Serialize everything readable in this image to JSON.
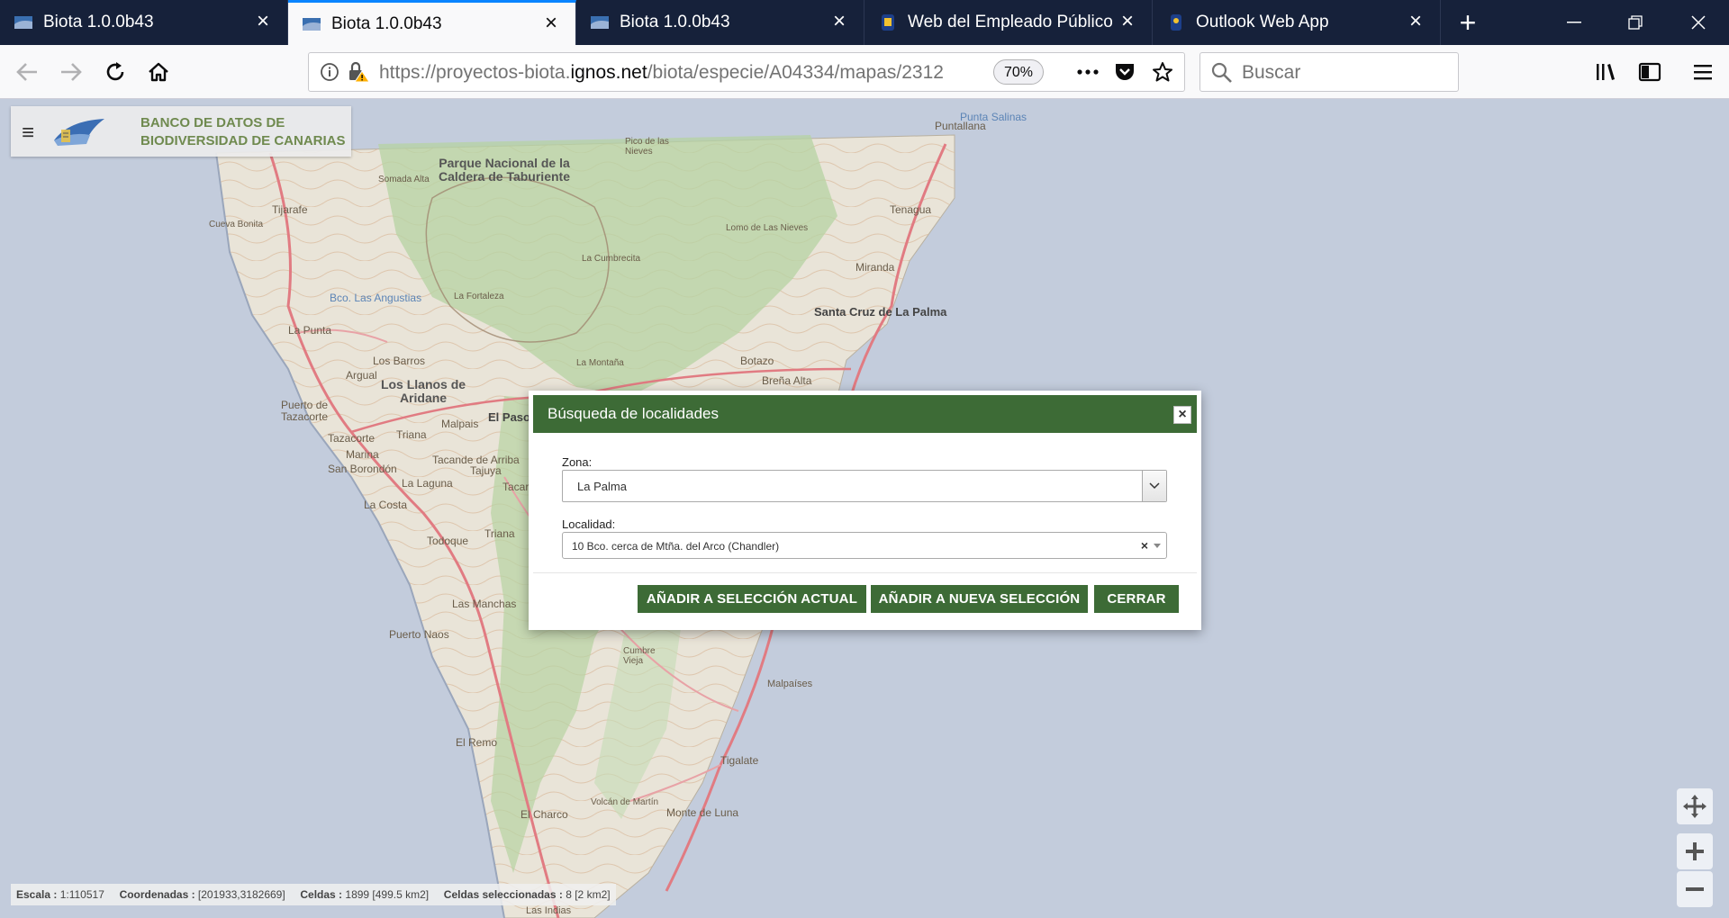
{
  "browser": {
    "tabs": [
      {
        "title": "Biota 1.0.0b43",
        "active": false,
        "icon": "biota-favicon"
      },
      {
        "title": "Biota 1.0.0b43",
        "active": true,
        "icon": "biota-favicon"
      },
      {
        "title": "Biota 1.0.0b43",
        "active": false,
        "icon": "biota-favicon"
      },
      {
        "title": "Web del Empleado Público - I",
        "active": false,
        "icon": "crest-favicon"
      },
      {
        "title": "Outlook Web App",
        "active": false,
        "icon": "crest-favicon"
      }
    ],
    "url": {
      "prefix": "https://proyectos-biota.",
      "domain": "ignos.net",
      "path": "/biota/especie/A04334/mapas/2312"
    },
    "zoom": "70%",
    "search_placeholder": "Buscar"
  },
  "brand": {
    "line1": "BANCO DE DATOS DE",
    "line2": "BIODIVERSIDAD DE CANARIAS"
  },
  "map_labels": [
    {
      "text": "Puntallana",
      "kind": "normal"
    },
    {
      "text": "Punta Salinas",
      "kind": "water"
    },
    {
      "text": "Pico de las Nieves",
      "kind": "normal"
    },
    {
      "text": "Parque Nacional de la Caldera de Taburiente",
      "kind": "big"
    },
    {
      "text": "Somada Alta",
      "kind": "normal"
    },
    {
      "text": "Tijarafe",
      "kind": "normal"
    },
    {
      "text": "Cueva Bonita",
      "kind": "normal"
    },
    {
      "text": "Tenagua",
      "kind": "normal"
    },
    {
      "text": "Lomo de Las Nieves",
      "kind": "normal"
    },
    {
      "text": "La Cumbrecita",
      "kind": "normal"
    },
    {
      "text": "Miranda",
      "kind": "normal"
    },
    {
      "text": "Bco. Las Angustias",
      "kind": "water"
    },
    {
      "text": "La Fortaleza",
      "kind": "normal"
    },
    {
      "text": "Santa Cruz de La Palma",
      "kind": "town"
    },
    {
      "text": "La Punta",
      "kind": "normal"
    },
    {
      "text": "Los Barros",
      "kind": "normal"
    },
    {
      "text": "La Montaña",
      "kind": "normal"
    },
    {
      "text": "Botazo",
      "kind": "normal"
    },
    {
      "text": "Argual",
      "kind": "normal"
    },
    {
      "text": "Los Llanos de Aridane",
      "kind": "big"
    },
    {
      "text": "Breña Alta",
      "kind": "normal"
    },
    {
      "text": "Puerto de Tazacorte",
      "kind": "normal"
    },
    {
      "text": "Malpais",
      "kind": "normal"
    },
    {
      "text": "El Paso",
      "kind": "town"
    },
    {
      "text": "Tazacorte",
      "kind": "normal"
    },
    {
      "text": "Triana",
      "kind": "normal"
    },
    {
      "text": "Marina",
      "kind": "normal"
    },
    {
      "text": "Tacande de Arriba",
      "kind": "normal"
    },
    {
      "text": "San Borondón",
      "kind": "normal"
    },
    {
      "text": "Tajuya",
      "kind": "normal"
    },
    {
      "text": "La Laguna",
      "kind": "normal"
    },
    {
      "text": "Tacar",
      "kind": "normal"
    },
    {
      "text": "La Costa",
      "kind": "normal"
    },
    {
      "text": "Triana",
      "kind": "normal"
    },
    {
      "text": "Todoque",
      "kind": "normal"
    },
    {
      "text": "Las Manchas",
      "kind": "normal"
    },
    {
      "text": "Puerto Naos",
      "kind": "normal"
    },
    {
      "text": "Cumbre Vieja",
      "kind": "normal"
    },
    {
      "text": "Malpaíses",
      "kind": "normal"
    },
    {
      "text": "El Remo",
      "kind": "normal"
    },
    {
      "text": "Tigalate",
      "kind": "normal"
    },
    {
      "text": "Volcán de Martín",
      "kind": "normal"
    },
    {
      "text": "El Charco",
      "kind": "normal"
    },
    {
      "text": "Monte de Luna",
      "kind": "normal"
    },
    {
      "text": "Las Indias",
      "kind": "normal"
    }
  ],
  "modal": {
    "title": "Búsqueda de localidades",
    "close_label": "×",
    "zona_label": "Zona:",
    "zona_value": "La Palma",
    "localidad_label": "Localidad:",
    "localidad_value": "10 Bco. cerca de Mtña. del Arco (Chandler)",
    "clear_label": "×",
    "buttons": {
      "add_current": "AÑADIR A SELECCIÓN ACTUAL",
      "add_new": "AÑADIR A NUEVA SELECCIÓN",
      "close": "CERRAR"
    }
  },
  "status": {
    "escala_label": "Escala :",
    "escala_value": "1:110517",
    "coords_label": "Coordenadas :",
    "coords_value": "[201933,3182669]",
    "celdas_label": "Celdas :",
    "celdas_value": "1899 [499.5 km2]",
    "celdas_sel_label": "Celdas seleccionadas :",
    "celdas_sel_value": "8 [2 km2]"
  },
  "colors": {
    "tabbar": "#16213a",
    "accent_tab": "#0a84ff",
    "modal_green": "#3d6b36",
    "brand_text": "#6f8a4f",
    "sea": "#c3ccdc",
    "land": "#e9e4d8",
    "forest": "#b6d3a3"
  }
}
